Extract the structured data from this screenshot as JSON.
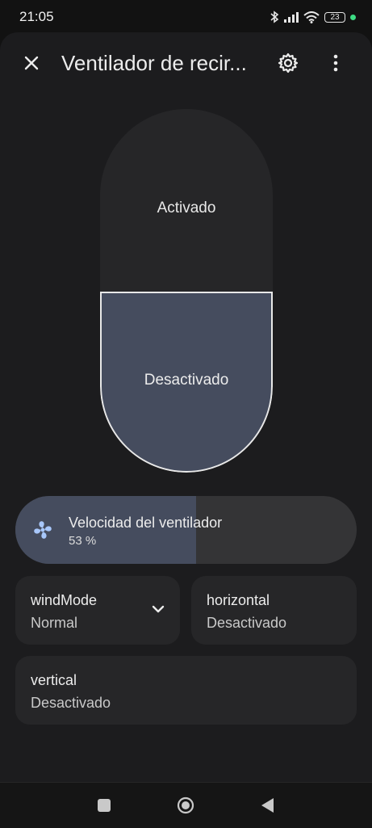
{
  "status": {
    "time": "21:05",
    "battery": "23",
    "icons": [
      "bluetooth-icon",
      "signal-icon",
      "wifi-icon",
      "battery-icon",
      "privacy-dot"
    ]
  },
  "header": {
    "title": "Ventilador de recir...",
    "close_icon": "close-icon",
    "settings_icon": "gear-icon",
    "more_icon": "more-vertical-icon"
  },
  "power_toggle": {
    "on_label": "Activado",
    "off_label": "Desactivado",
    "selected": "off"
  },
  "speed": {
    "label": "Velocidad del ventilador",
    "value_text": "53 %",
    "level": 0.53,
    "icon": "fan-icon"
  },
  "tiles": {
    "wind_mode": {
      "title": "windMode",
      "value": "Normal",
      "icon": "chevron-down-icon"
    },
    "horizontal": {
      "title": "horizontal",
      "value": "Desactivado"
    },
    "vertical": {
      "title": "vertical",
      "value": "Desactivado"
    }
  },
  "nav": {
    "recents_icon": "recents-square-icon",
    "home_icon": "home-circle-icon",
    "back_icon": "back-triangle-icon"
  },
  "colors": {
    "background": "#121212",
    "sheet": "#1c1c1e",
    "tile": "#262628",
    "active_fill": "#454c5e",
    "fan_icon": "#a8c7fa"
  }
}
